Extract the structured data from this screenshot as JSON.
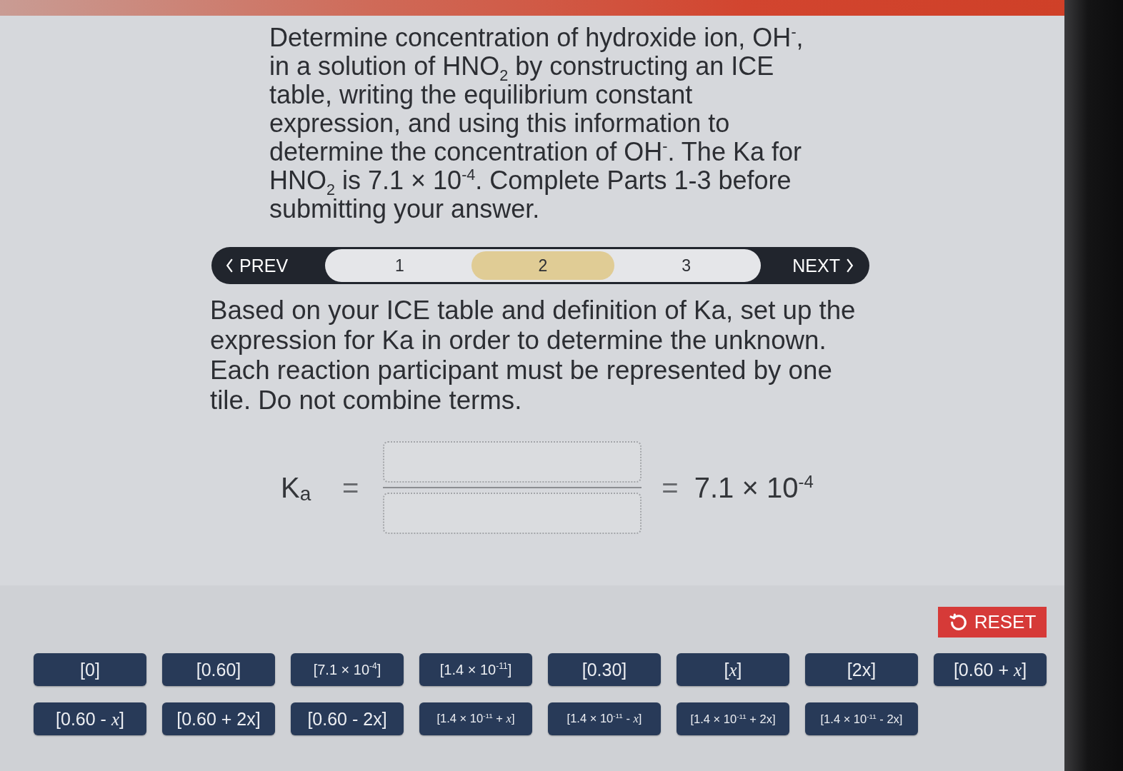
{
  "question": "Determine concentration of hydroxide ion, OH$^{-}$, in a solution of HNO$_{2}$ by constructing an ICE table, writing the equilibrium constant expression, and using this information to determine the concentration of OH$^{-}$. The Ka for HNO$_{2}$ is 7.1 × 10$^{-4}$. Complete Parts 1-3 before submitting your answer.",
  "step_nav": {
    "prev": "PREV",
    "next": "NEXT",
    "steps": [
      {
        "label": "1",
        "selected": false
      },
      {
        "label": "2",
        "selected": true
      },
      {
        "label": "3",
        "selected": false
      }
    ]
  },
  "instructions": "Based on your ICE table and definition of Ka, set up the expression for Ka in order to determine the unknown. Each reaction participant must be represented by one tile. Do not combine terms.",
  "equation": {
    "lhs": "K$_{a}$",
    "lhs_equals": "=",
    "rhs_equals": "=",
    "rhs": "7.1 × 10$^{-4}$"
  },
  "reset_button": "RESET",
  "tiles": [
    "[0]",
    "[0.60]",
    "[7.1 × 10$^{-4}$]",
    "[1.4 × 10$^{-11}$]",
    "[0.30]",
    "[*x*]",
    "[2x]",
    "[0.60 + *x*]",
    "[0.60 - *x*]",
    "[0.60 + 2x]",
    "[0.60 - 2x]",
    "[1.4 × 10$^{-11}$ + *x*]",
    "[1.4 × 10$^{-11}$ - *x*]",
    "[1.4 × 10$^{-11}$ + 2x]",
    "[1.4 × 10$^{-11}$ - 2x]"
  ]
}
